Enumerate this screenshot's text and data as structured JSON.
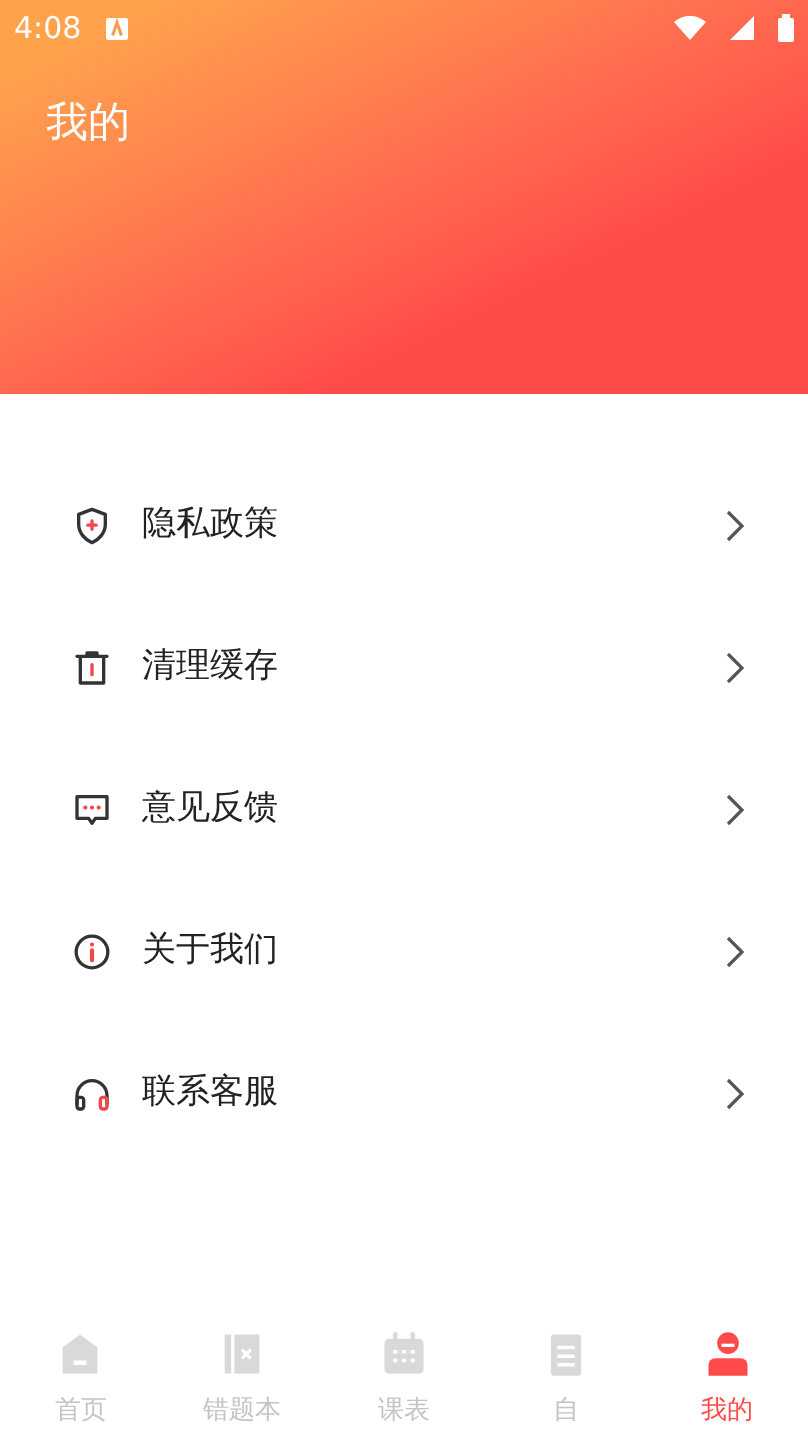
{
  "status_bar": {
    "time": "4:08"
  },
  "header": {
    "title": "我的"
  },
  "menu": [
    {
      "label": "隐私政策"
    },
    {
      "label": "清理缓存"
    },
    {
      "label": "意见反馈"
    },
    {
      "label": "关于我们"
    },
    {
      "label": "联系客服"
    }
  ],
  "tabs": [
    {
      "label": "首页",
      "selected": false
    },
    {
      "label": "错题本",
      "selected": false
    },
    {
      "label": "课表",
      "selected": false
    },
    {
      "label": "自",
      "selected": false
    },
    {
      "label": "我的",
      "selected": true
    }
  ]
}
